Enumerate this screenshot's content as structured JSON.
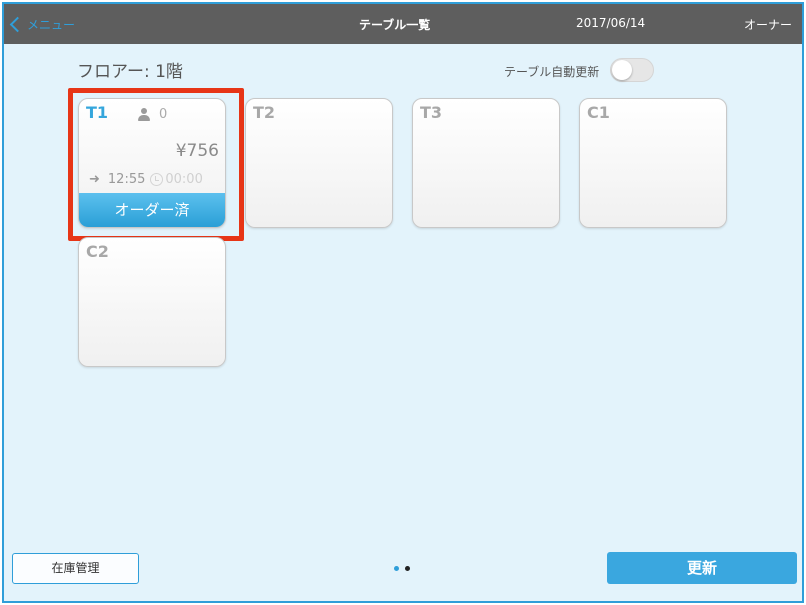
{
  "header": {
    "back_label": "メニュー",
    "title": "テーブル一覧",
    "date": "2017/06/14",
    "user": "オーナー"
  },
  "floor_label": "フロアー: 1階",
  "auto_update": {
    "label": "テーブル自動更新",
    "enabled": false
  },
  "tables": [
    {
      "name": "T1",
      "guests": "0",
      "price": "¥756",
      "time_in": "12:55",
      "elapsed": "00:00",
      "status": "オーダー済"
    },
    {
      "name": "T2"
    },
    {
      "name": "T3"
    },
    {
      "name": "C1"
    },
    {
      "name": "C2"
    }
  ],
  "footer": {
    "inventory_label": "在庫管理",
    "refresh_label": "更新",
    "pages": 2,
    "current_page": 1
  },
  "colors": {
    "accent": "#2f9ed9",
    "header_bg": "#5e5e5e",
    "highlight": "#e73516",
    "background": "#e3f3fb"
  },
  "icons": [
    "chevron-left-icon",
    "person-icon",
    "sign-in-icon",
    "clock-icon"
  ]
}
